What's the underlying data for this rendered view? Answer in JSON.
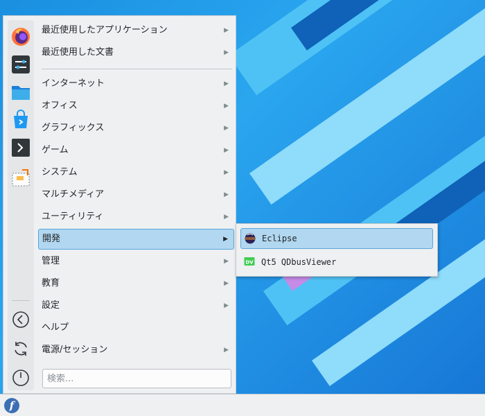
{
  "menu": {
    "categories": [
      {
        "label": "最近使用したアプリケーション",
        "has_submenu": true
      },
      {
        "label": "最近使用した文書",
        "has_submenu": true
      },
      {
        "label": "インターネット",
        "has_submenu": true
      },
      {
        "label": "オフィス",
        "has_submenu": true
      },
      {
        "label": "グラフィックス",
        "has_submenu": true
      },
      {
        "label": "ゲーム",
        "has_submenu": true
      },
      {
        "label": "システム",
        "has_submenu": true
      },
      {
        "label": "マルチメディア",
        "has_submenu": true
      },
      {
        "label": "ユーティリティ",
        "has_submenu": true
      },
      {
        "label": "開発",
        "has_submenu": true,
        "active": true
      },
      {
        "label": "管理",
        "has_submenu": true
      },
      {
        "label": "教育",
        "has_submenu": true
      },
      {
        "label": "設定",
        "has_submenu": true
      },
      {
        "label": "ヘルプ",
        "has_submenu": false
      },
      {
        "label": "電源/セッション",
        "has_submenu": true
      }
    ],
    "arrow_glyph": "▶",
    "search_placeholder": "検索..."
  },
  "favorites": [
    {
      "icon": "firefox-icon"
    },
    {
      "icon": "system-settings-icon"
    },
    {
      "icon": "file-manager-icon"
    },
    {
      "icon": "software-store-icon"
    },
    {
      "icon": "terminal-icon"
    },
    {
      "icon": "screenshot-tool-icon"
    }
  ],
  "system_buttons": [
    {
      "icon": "back-icon"
    },
    {
      "icon": "restart-icon"
    },
    {
      "icon": "power-icon"
    }
  ],
  "submenu": {
    "items": [
      {
        "label": "Eclipse",
        "icon": "eclipse-icon",
        "active": true
      },
      {
        "label": "Qt5 QDbusViewer",
        "icon": "qdbusviewer-icon",
        "icon_text": "DV",
        "active": false
      }
    ]
  },
  "panel": {
    "launcher_glyph": "f"
  },
  "colors": {
    "accent": "#58a6db",
    "highlight": "#b2d7f0",
    "menu_bg": "#eef0f2"
  }
}
